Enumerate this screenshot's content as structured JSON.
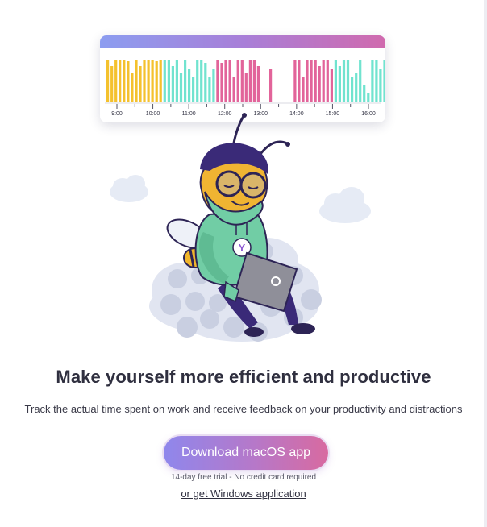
{
  "timeline": {
    "time_labels": [
      "9:00",
      "10:00",
      "11:00",
      "12:00",
      "13:00",
      "14:00",
      "15:00",
      "16:00"
    ],
    "colors": {
      "productive": "#f4c12d",
      "neutral": "#71e3cf",
      "distracting": "#e2649a",
      "empty": "#ffffff"
    }
  },
  "hero": {
    "headline": "Make yourself more efficient and productive",
    "subtitle": "Track the actual time spent on work and receive feedback on your productivity and distractions"
  },
  "cta": {
    "download_label": "Download macOS app",
    "trial_note": "14-day free trial - No credit card required",
    "windows_link": "or get Windows application"
  },
  "mascot": {
    "badge_letter": "Y"
  },
  "colors": {
    "accent_start": "#8f87ec",
    "accent_end": "#d86aa0",
    "text_dark": "#2f2f3f"
  }
}
